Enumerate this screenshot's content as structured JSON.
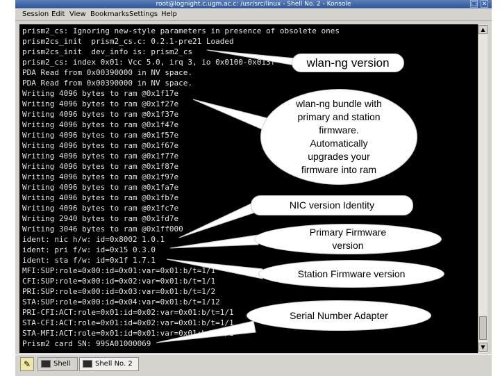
{
  "window": {
    "title": "root@lognight.c.ugm.ac.c: /usr/src/linux - Shell No. 2 - Konsole"
  },
  "menu": [
    "Session",
    "Edit",
    "View",
    "Bookmarks",
    "Settings",
    "Help"
  ],
  "terminal_lines": [
    "prism2_cs: Ignoring new-style parameters in presence of obsolete ones",
    "prism2cs_init  prism2_cs.c: 0.2.1-pre21 Loaded",
    "prism2cs_init  dev_info is: prism2_cs",
    "prism2_cs: index 0x01: Vcc 5.0, irq 3, io 0x0100-0x013f",
    "PDA Read from 0x00390000 in NV space.",
    "PDA Read from 0x00390000 in NV space.",
    "Writing 4096 bytes to ram @0x1f17e",
    "Writing 4096 bytes to ram @0x1f27e",
    "Writing 4096 bytes to ram @0x1f37e",
    "Writing 4096 bytes to ram @0x1f47e",
    "Writing 4096 bytes to ram @0x1f57e",
    "Writing 4096 bytes to ram @0x1f67e",
    "Writing 4096 bytes to ram @0x1f77e",
    "Writing 4096 bytes to ram @0x1f87e",
    "Writing 4096 bytes to ram @0x1f97e",
    "Writing 4096 bytes to ram @0x1fa7e",
    "Writing 4096 bytes to ram @0x1fb7e",
    "Writing 4096 bytes to ram @0x1fc7e",
    "Writing 2940 bytes to ram @0x1fd7e",
    "Writing 3046 bytes to ram @0x1ff000",
    "ident: nic h/w: id=0x8002 1.0.1",
    "ident: pri f/w: id=0x15 0.3.0",
    "ident: sta f/w: id=0x1f 1.7.1",
    "MFI:SUP:role=0x00:id=0x01:var=0x01:b/t=1/1",
    "CFI:SUP:role=0x00:id=0x02:var=0x01:b/t=1/1",
    "PRI:SUP:role=0x00:id=0x03:var=0x01:b/t=1/2",
    "STA:SUP:role=0x00:id=0x04:var=0x01:b/t=1/12",
    "PRI-CFI:ACT:role=0x01:id=0x02:var=0x01:b/t=1/1",
    "STA-CFI:ACT:role=0x01:id=0x02:var=0x01:b/t=1/1",
    "STA-MFI:ACT:role=0x01:id=0x01:var=0x01:b/t=1/1",
    "Prism2 card SN: 99SA01000069"
  ],
  "callouts": {
    "version": "wlan-ng version",
    "bundle": "wlan-ng bundle with primary and station firmware. Automatically upgrades your firmware into ram",
    "nic": "NIC version Identity",
    "primary": "Primary Firmware version",
    "station": "Station Firmware version",
    "serial": "Serial Number Adapter"
  },
  "taskbar": {
    "tabs": [
      "Shell",
      "Shell No. 2"
    ],
    "active_tab": 1
  }
}
